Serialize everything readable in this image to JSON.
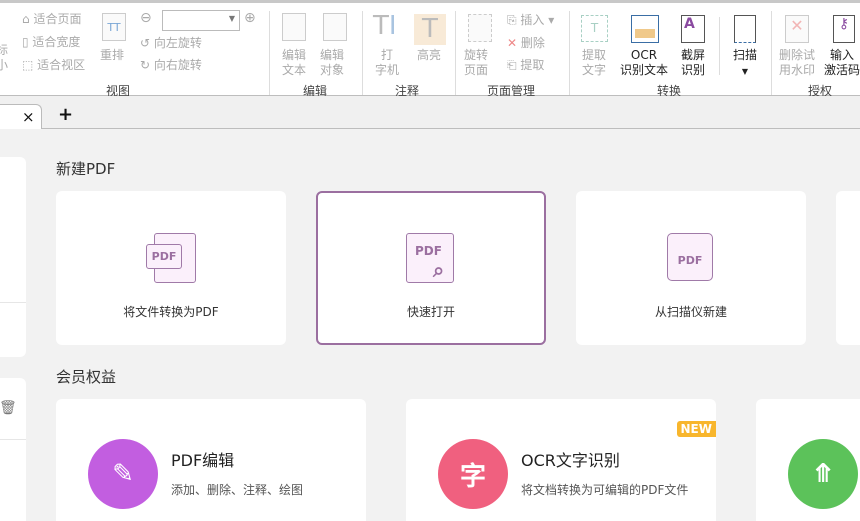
{
  "ribbon": {
    "view": {
      "partial_label": "标\n小",
      "fit_page": "适合页面",
      "fit_width": "适合宽度",
      "fit_view": "适合视区",
      "reflow": "重排",
      "zoom_value": "",
      "rotate_left": "向左旋转",
      "rotate_right": "向右旋转",
      "group": "视图"
    },
    "edit": {
      "edit_text": "编辑\n文本",
      "edit_object": "编辑\n对象",
      "group": "编辑"
    },
    "annotate": {
      "typewriter": "打\n字机",
      "highlight": "高亮",
      "group": "注释"
    },
    "pages": {
      "rotate_page": "旋转\n页面",
      "insert": "插入",
      "delete": "删除",
      "extract": "提取",
      "group": "页面管理"
    },
    "convert": {
      "extract_text": "提取\n文字",
      "ocr": "OCR\n识别文本",
      "screenshot_ocr": "截屏\n识别",
      "scan": "扫描",
      "group": "转换"
    },
    "license": {
      "remove_watermark": "删除试\n用水印",
      "activation": "输入\n激活码",
      "group": "授权"
    }
  },
  "tabs": {
    "close": "×",
    "add": "+"
  },
  "new_pdf": {
    "title": "新建PDF",
    "cards": [
      {
        "label": "将文件转换为PDF",
        "icon": "pdf-convert-icon"
      },
      {
        "label": "快速打开",
        "icon": "pdf-search-icon",
        "selected": true
      },
      {
        "label": "从扫描仪新建",
        "icon": "scanner-icon"
      }
    ]
  },
  "member": {
    "title": "会员权益",
    "cards": [
      {
        "title": "PDF编辑",
        "desc": "添加、删除、注释、绘图",
        "color": "#c25ee0",
        "glyph": "✎"
      },
      {
        "title": "OCR文字识别",
        "desc": "将文档转换为可编辑的PDF文件",
        "color": "#f0607f",
        "glyph": "字",
        "badge": "NEW"
      },
      {
        "title": "",
        "desc": "",
        "color": "#5cc25a",
        "glyph": "⤊"
      }
    ]
  },
  "colors": {
    "accent": "#9b6fa0",
    "badge": "#f8b62d"
  }
}
